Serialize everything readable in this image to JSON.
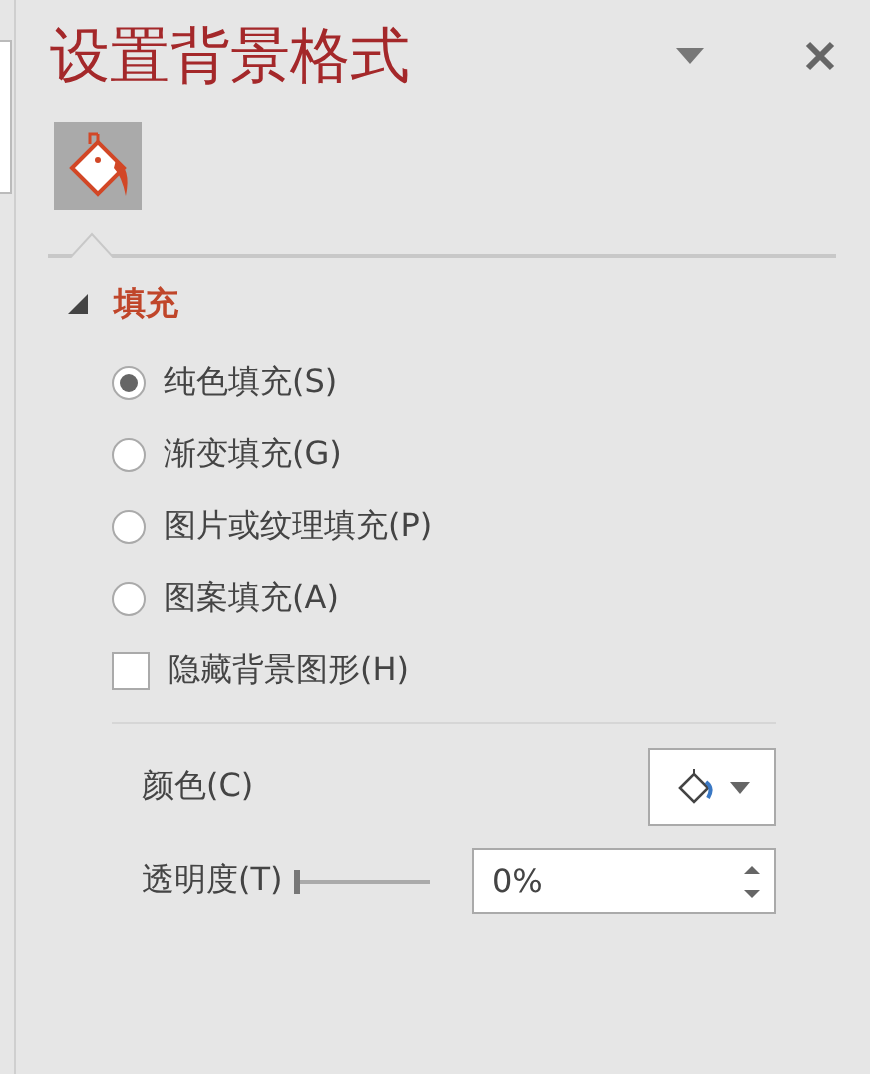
{
  "pane": {
    "title": "设置背景格式",
    "tabs": [
      {
        "kind": "fill",
        "selected": true
      }
    ],
    "section": {
      "title": "填充",
      "expanded": true,
      "options": [
        {
          "kind": "radio",
          "label": "纯色填充(S)",
          "selected": true
        },
        {
          "kind": "radio",
          "label": "渐变填充(G)",
          "selected": false
        },
        {
          "kind": "radio",
          "label": "图片或纹理填充(P)",
          "selected": false
        },
        {
          "kind": "radio",
          "label": "图案填充(A)",
          "selected": false
        },
        {
          "kind": "checkbox",
          "label": "隐藏背景图形(H)",
          "checked": false
        }
      ],
      "color": {
        "label": "颜色(C)"
      },
      "transparency": {
        "label": "透明度(T)",
        "level": 0,
        "value": "0%"
      }
    }
  }
}
